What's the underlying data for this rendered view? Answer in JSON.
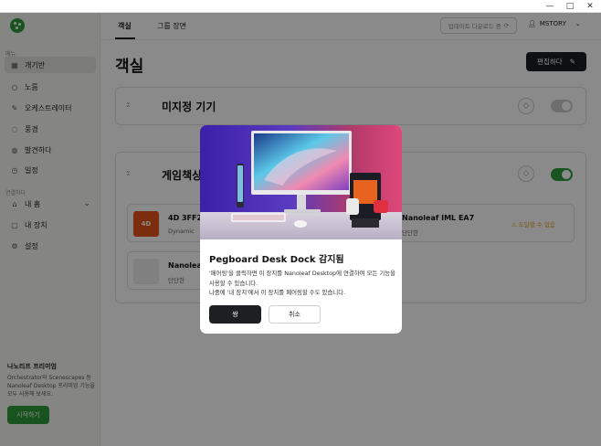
{
  "window": {
    "minimize": "—",
    "maximize": "□",
    "close": "✕"
  },
  "sidebar": {
    "section_top": "메뉴",
    "items": [
      {
        "label": "개기반",
        "icon": "grid-icon",
        "glyph": "▦"
      },
      {
        "label": "노름",
        "icon": "bulb-icon",
        "glyph": "○"
      },
      {
        "label": "오케스트레이터",
        "icon": "wand-icon",
        "glyph": "✎"
      },
      {
        "label": "풍경",
        "icon": "scene-icon",
        "glyph": "◌"
      },
      {
        "label": "발견하다",
        "icon": "compass-icon",
        "glyph": "◍"
      },
      {
        "label": "일정",
        "icon": "clock-icon",
        "glyph": "◷"
      }
    ],
    "section_bottom": "연결하다",
    "items2": [
      {
        "label": "내 홈",
        "icon": "home-icon",
        "glyph": "⌂",
        "chevron": "⌄"
      },
      {
        "label": "내 장치",
        "icon": "device-icon",
        "glyph": "▢"
      },
      {
        "label": "설정",
        "icon": "gear-icon",
        "glyph": "⚙"
      }
    ],
    "premium_title": "나노리프 프리미엄",
    "premium_desc": "Orchestrator와 Scenescapes 등 Nanoleaf Desktop 프리미엄 기능을 모두 사용해 보세요.",
    "start_button": "시작하기"
  },
  "topnav": {
    "tabs": [
      {
        "label": "객실"
      },
      {
        "label": "그룹 장면"
      }
    ],
    "update_button": "업데이트 다운로드 중",
    "user_name": "MSTORY"
  },
  "main": {
    "page_title": "객실",
    "edit_button": "편집하다",
    "groups": [
      {
        "title": "미지정 기기",
        "toggle_on": false
      },
      {
        "title": "게임책상",
        "toggle_on": true
      }
    ],
    "devices": [
      {
        "name": "4D 3FF2",
        "sub": "Dynamic",
        "thumb": "4D"
      },
      {
        "name": "Nanoleaf IML EA7",
        "sub": "단단한",
        "status": "도달할 수 없음"
      },
      {
        "name": "Nanoleaf",
        "sub": "단단한"
      }
    ]
  },
  "modal": {
    "title": "Pegboard Desk Dock 감지됨",
    "body_line1": "'페어링'을 클릭하면 이 장치를 Nanoleaf Desktop에 연결하여 모든 기능을 사용할 수 있습니다.",
    "body_line2": "나중에 '내 장치'에서 이 장치를 페어링할 수도 있습니다.",
    "pair_button": "쌍",
    "cancel_button": "취소"
  },
  "colors": {
    "accent": "#2f9a3a",
    "dark_button": "#1d1f22",
    "warning": "#e0a020"
  }
}
